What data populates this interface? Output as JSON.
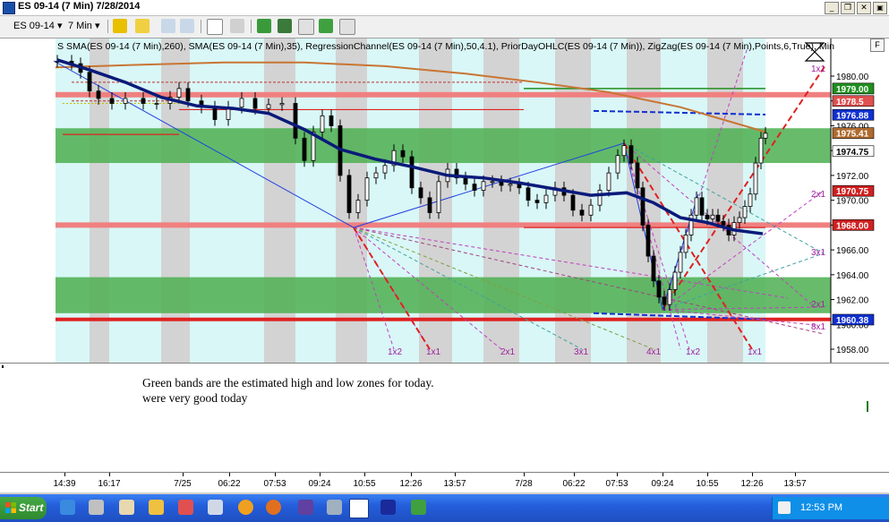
{
  "window": {
    "title": "ES 09-14 (7 Min)  7/28/2014",
    "btn_min": "_",
    "btn_restore": "❐",
    "btn_close": "✕"
  },
  "toolbar": {
    "instrument": "ES 09-14",
    "interval": "7 Min",
    "dropdown_glyph": "▾"
  },
  "chart": {
    "f_button": "F",
    "legend": "SMA(ES 09-14 (7 Min),260), SMA(ES 09-14 (7 Min),35), RegressionChannel(ES 09-14 (7 Min),50,4.1), PriorDayOHLC(ES 09-14 (7 Min)), ZigZag(ES 09-14 (7 Min),Points,6,True), Min",
    "legend_prefix": "S",
    "price_ticks": [
      "1980.00",
      "1978.00",
      "1976.00",
      "1974.00",
      "1972.00",
      "1970.00",
      "1968.00",
      "1966.00",
      "1964.00",
      "1962.00",
      "1960.00",
      "1958.00"
    ],
    "price_tags": [
      {
        "label": "1979.00",
        "bg": "#1f8f1f",
        "fg": "#ffffff"
      },
      {
        "label": "1978.5",
        "bg": "#e05050",
        "fg": "#ffffff"
      },
      {
        "label": "1976.88",
        "bg": "#1030d0",
        "fg": "#ffffff"
      },
      {
        "label": "1975.41",
        "bg": "#b06a2e",
        "fg": "#ffffff"
      },
      {
        "label": "1974.75",
        "bg": "#ffffff",
        "fg": "#000000"
      },
      {
        "label": "1970.75",
        "bg": "#d02020",
        "fg": "#ffffff"
      },
      {
        "label": "1968.00",
        "bg": "#d02020",
        "fg": "#ffffff"
      },
      {
        "label": "1960.38",
        "bg": "#1030d0",
        "fg": "#ffffff"
      }
    ],
    "gann_labels": [
      "1x1",
      "2x1",
      "3x1",
      "2x1",
      "8x1",
      "1x2",
      "1x1",
      "2x1",
      "3x1",
      "4x1",
      "1x2",
      "1x1"
    ],
    "colors": {
      "green_band": "#4caf50",
      "cyan_session": "#d9f7f7",
      "gray_session": "#d3d3d3",
      "sma260": "#c87533",
      "sma35": "#0a1a7a",
      "zigzag": "#2040e0",
      "gann_red": "#e02020",
      "prior_day_red": "#e04040"
    }
  },
  "annotation": {
    "line1": "Green bands are the estimated high and low zones for today.",
    "line2": "were very good today"
  },
  "time_axis": {
    "labels": [
      "14:39",
      "16:17",
      "7/25",
      "06:22",
      "07:53",
      "09:24",
      "10:55",
      "12:26",
      "13:57",
      "7/28",
      "06:22",
      "07:53",
      "09:24",
      "10:55",
      "12:26",
      "13:57"
    ]
  },
  "taskbar": {
    "start_label": "Start",
    "clock": "12:53 PM"
  }
}
